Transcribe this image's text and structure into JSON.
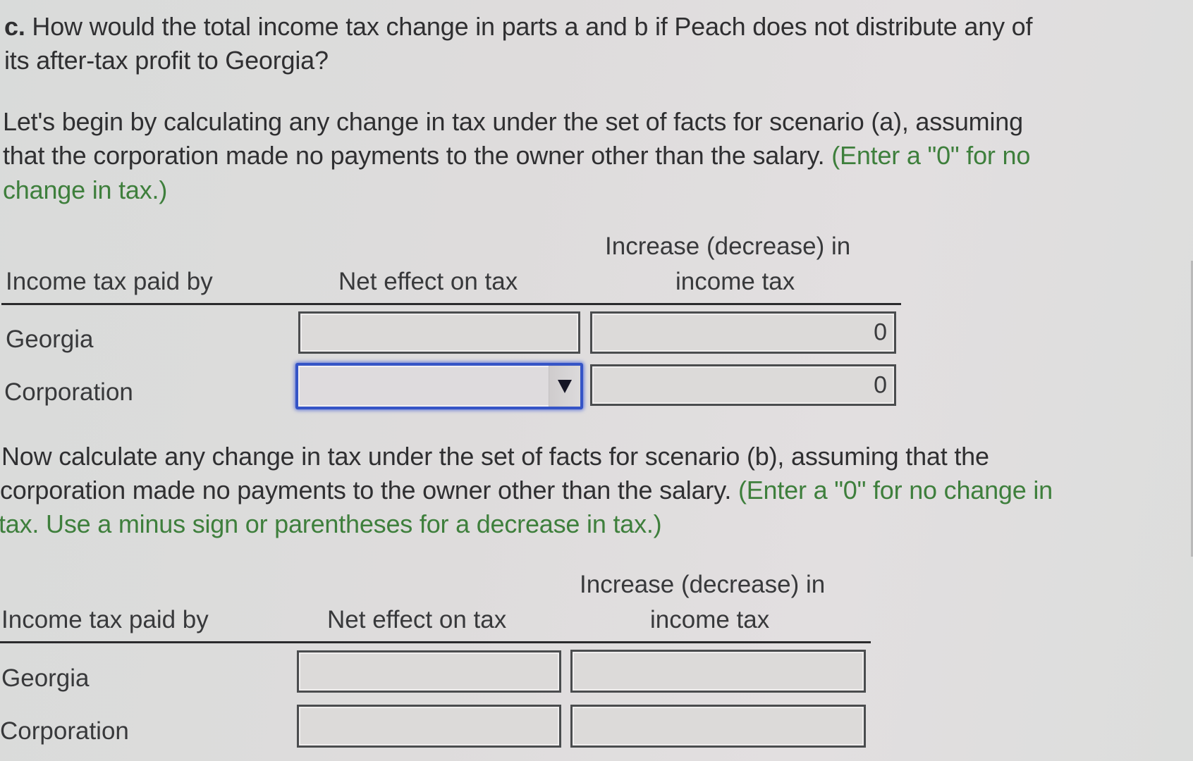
{
  "question": {
    "label": "c.",
    "line1": " How would the total income tax change in parts a and b if Peach does not distribute any of",
    "line2": "its after-tax profit to Georgia?"
  },
  "scenario_a": {
    "instructions": {
      "line1": "Let's begin by calculating any change in tax under the set of facts for scenario (a), assuming",
      "line2_plain": "that the corporation made no payments to the owner other than the salary. ",
      "line2_green": "(Enter a \"0\" for no",
      "line3_green": "change in tax.)"
    },
    "table": {
      "headers": {
        "col1": "Income tax paid by",
        "col2": "Net effect on tax",
        "col3_line1": "Increase (decrease) in",
        "col3_line2": "income tax"
      },
      "rows": [
        {
          "label": "Georgia",
          "net_effect": "",
          "change": "0"
        },
        {
          "label": "Corporation",
          "net_effect": "",
          "net_effect_control": "dropdown",
          "change": "0"
        }
      ]
    }
  },
  "scenario_b": {
    "instructions": {
      "line1": "Now calculate any change in tax under the set of facts for scenario (b), assuming that the",
      "line2_plain": "corporation made no payments to the owner other than the salary. ",
      "line2_green": "(Enter a \"0\" for no change in",
      "line3_green": "tax. Use a minus sign or parentheses for a decrease in tax.)"
    },
    "table": {
      "headers": {
        "col1": "Income tax paid by",
        "col2": "Net effect on tax",
        "col3_line1": "Increase (decrease) in",
        "col3_line2": "income tax"
      },
      "rows": [
        {
          "label": "Georgia",
          "net_effect": "",
          "change": ""
        },
        {
          "label": "Corporation",
          "net_effect": "",
          "change": ""
        }
      ]
    }
  },
  "icons": {
    "dropdown": "triangle-down"
  },
  "colors": {
    "text": "#2f2f31",
    "hint_green": "#3e7f3c",
    "focus_blue": "#3554c6"
  }
}
